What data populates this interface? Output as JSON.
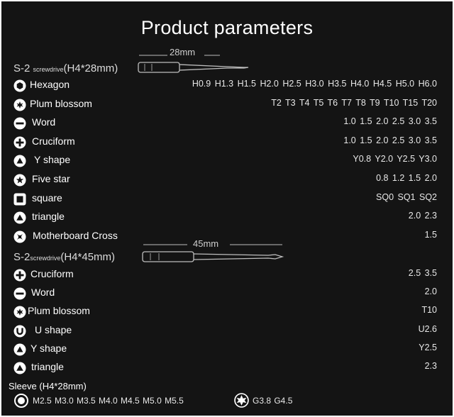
{
  "title": "Product parameters",
  "section1": {
    "prefix": "S-2 ",
    "small": "screwdrive",
    "size": "(H4*28mm)",
    "dimension": "28mm"
  },
  "rows1": [
    {
      "icon": "hexagon-icon",
      "label": "Hexagon",
      "values": "H0.9 H1.3 H1.5 H2.0 H2.5 H3.0 H3.5 H4.0 H4.5 H5.0 H6.0"
    },
    {
      "icon": "plum-blossom-icon",
      "label": "Plum blossom",
      "values": "T2 T3 T4 T5 T6 T7 T8 T9 T10 T15 T20"
    },
    {
      "icon": "word-slot-icon",
      "label": "Word",
      "values": "1.0 1.5 2.0 2.5 3.0 3.5"
    },
    {
      "icon": "cruciform-icon",
      "label": "Cruciform",
      "values": "1.0 1.5 2.0 2.5 3.0 3.5"
    },
    {
      "icon": "y-shape-icon",
      "label": "Y shape",
      "values": "Y0.8 Y2.0 Y2.5 Y3.0"
    },
    {
      "icon": "five-star-icon",
      "label": "Five star",
      "values": "0.8 1.2 1.5 2.0"
    },
    {
      "icon": "square-icon",
      "label": "square",
      "values": "SQ0 SQ1 SQ2"
    },
    {
      "icon": "triangle-icon",
      "label": "triangle",
      "values": "2.0 2.3"
    },
    {
      "icon": "motherboard-cross-icon",
      "label": "Motherboard Cross",
      "values": "1.5"
    }
  ],
  "section2": {
    "prefix": "S-2",
    "small": "screwdrive",
    "size": "(H4*45mm)",
    "dimension": "45mm"
  },
  "rows2": [
    {
      "icon": "cruciform-icon",
      "label": "Cruciform",
      "values": "2.5 3.5"
    },
    {
      "icon": "word-slot-icon",
      "label": "Word",
      "values": "2.0"
    },
    {
      "icon": "plum-blossom-icon",
      "label": "Plum blossom",
      "values": "T10"
    },
    {
      "icon": "u-shape-icon",
      "label": "U shape",
      "values": "U2.6"
    },
    {
      "icon": "y-shape-icon",
      "label": "Y shape",
      "values": "Y2.5"
    },
    {
      "icon": "triangle-icon",
      "label": "triangle",
      "values": "2.3"
    }
  ],
  "sleeve": {
    "label": "Sleeve (H4*28mm)",
    "hex_values": "M2.5 M3.0 M3.5 M4.0 M4.5 M5.0 M5.5",
    "star_values": "G3.8 G4.5"
  },
  "colors": {
    "background": "#141414",
    "text": "#ffffff",
    "icon_fill": "#ffffff"
  }
}
